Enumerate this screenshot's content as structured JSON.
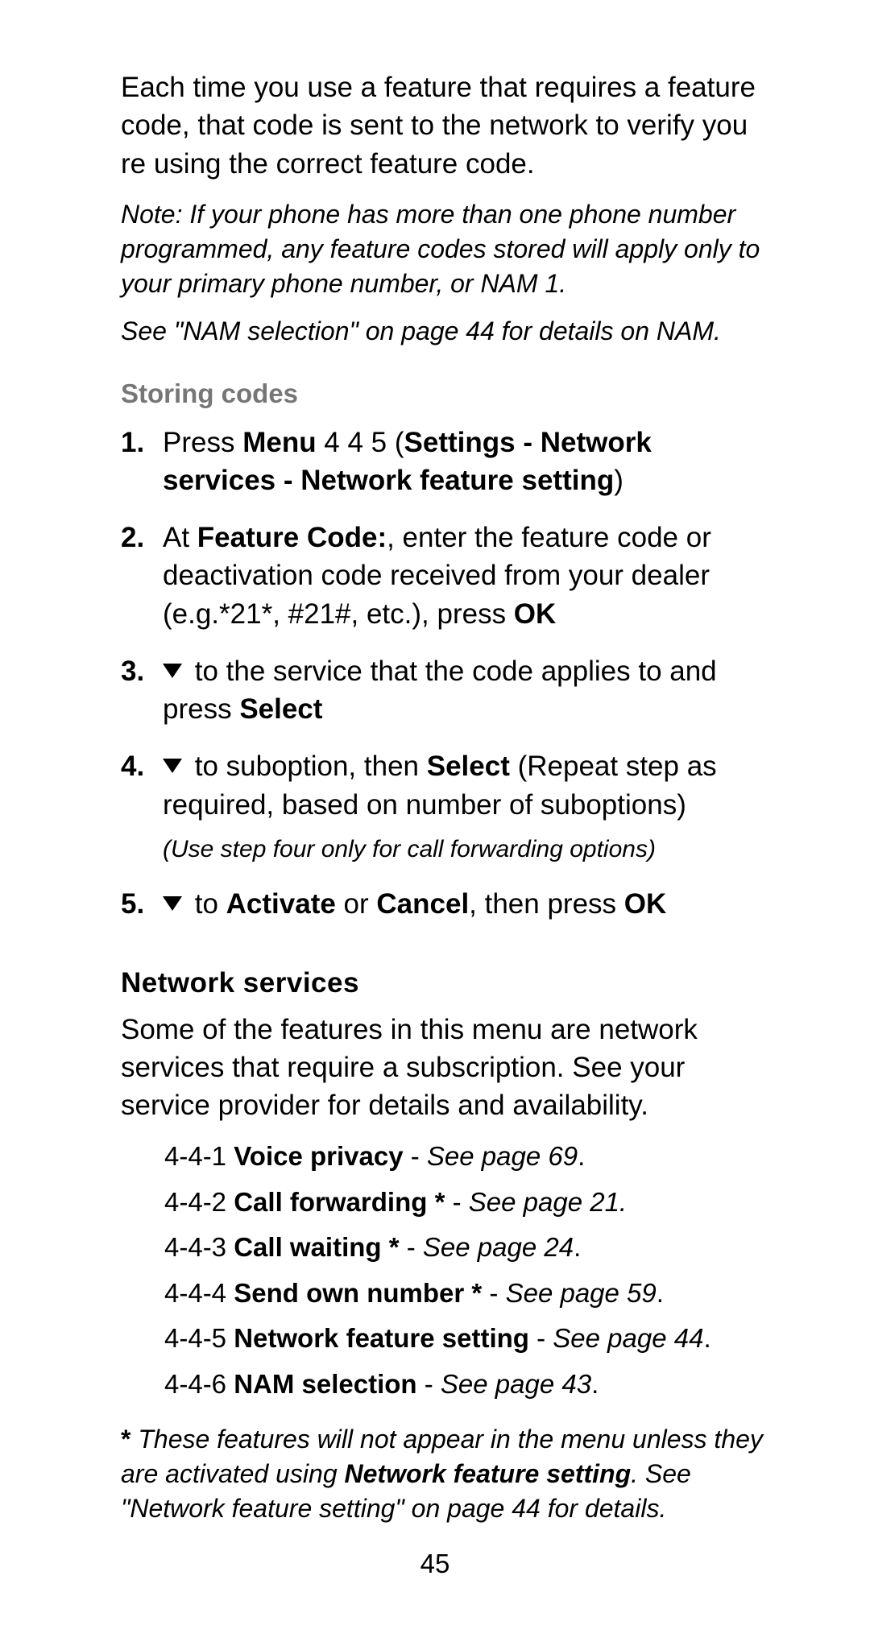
{
  "intro": "Each time you use a feature that requires a feature code, that code is sent to the network to verify you re using the correct feature code.",
  "note1": "Note: If your phone has more than one phone number programmed, any feature codes stored will apply only to your primary phone number, or NAM 1.",
  "note2": "See \"NAM selection\" on page 44 for details on NAM.",
  "storing_codes_heading": "Storing codes",
  "steps": {
    "s1": {
      "num": "1.",
      "t1": "Press",
      "menu": " Menu ",
      "t2": "4 4 5 (",
      "path": "Settings - Network services - Network feature setting",
      "t3": ")"
    },
    "s2": {
      "num": "2.",
      "t1": "At ",
      "fc": "Feature Code:",
      "t2": ", enter the feature code or deactivation code received from your dealer (e.g.*21*, #21#, etc.), press",
      "ok": " OK"
    },
    "s3": {
      "num": "3.",
      "t1": " to the service that the code applies to and press ",
      "sel": "Select"
    },
    "s4": {
      "num": "4.",
      "t1": " to suboption, then ",
      "sel": "Select",
      "t2": " (Repeat step as required, based on number of suboptions)",
      "sub": "(Use step four only for call forwarding options)"
    },
    "s5": {
      "num": "5.",
      "t1": " to ",
      "act": "Activate",
      "t2": " or ",
      "can": "Cancel",
      "t3": ", then press",
      "ok": " OK"
    }
  },
  "ns_heading": "Network services",
  "ns_intro": "Some of the features in this menu are network services that require a subscription. See your service provider for details and availability.",
  "menu": {
    "m1": {
      "code": "4-4-1 ",
      "name": "Voice privacy",
      "dash": " - ",
      "ref": "See page 69",
      "tail": "."
    },
    "m2": {
      "code": "4-4-2 ",
      "name": "Call forwarding *",
      "dash": " - ",
      "ref": "See page 21.",
      "tail": ""
    },
    "m3": {
      "code": "4-4-3 ",
      "name": "Call waiting *",
      "dash": " - ",
      "ref": "See page 24",
      "tail": "."
    },
    "m4": {
      "code": "4-4-4 ",
      "name": "Send own number *",
      "dash": " - ",
      "ref": "See page 59",
      "tail": "."
    },
    "m5": {
      "code": "4-4-5 ",
      "name": "Network feature setting",
      "dash": " - ",
      "ref": "See page 44",
      "tail": "."
    },
    "m6": {
      "code": "4-4-6 ",
      "name": "NAM selection",
      "dash": " - ",
      "ref": "See page 43",
      "tail": "."
    }
  },
  "footnote": {
    "star": "* ",
    "t1": "These features will not appear in the menu unless they are activated using ",
    "nfs": "Network feature setting",
    "t2": ". See \"Network feature setting\" on page 44 for details."
  },
  "page_number": "45"
}
